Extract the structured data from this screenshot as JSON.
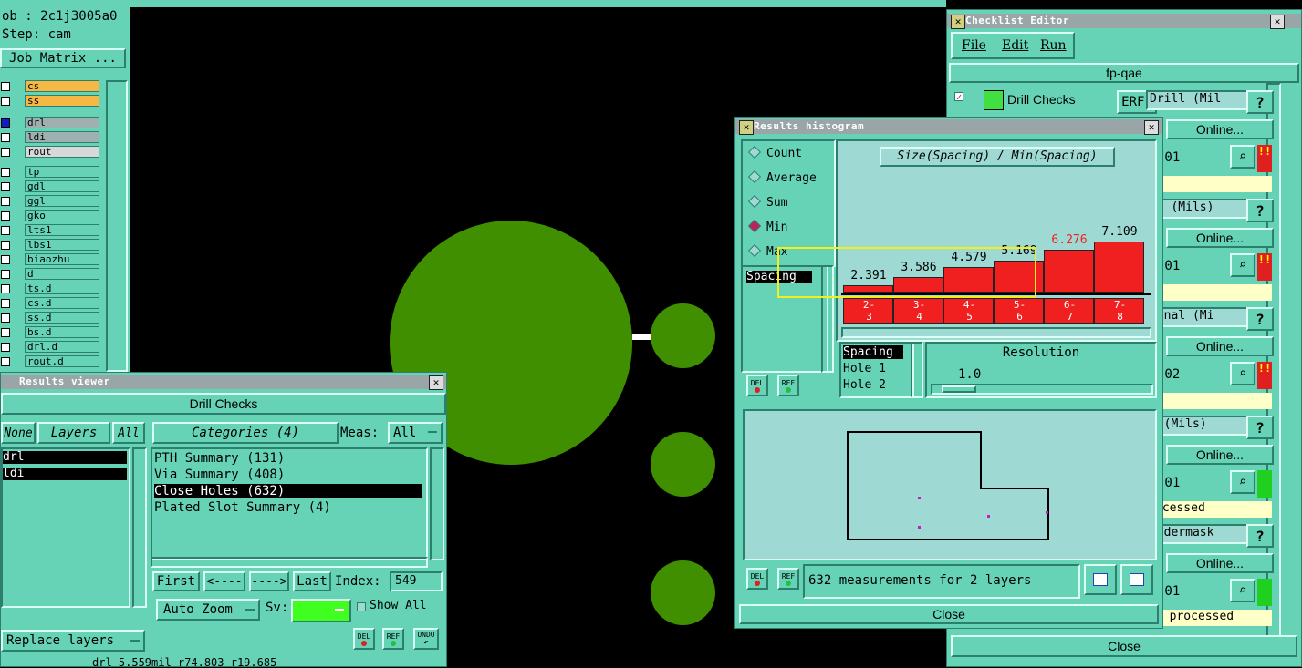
{
  "job_panel": {
    "job": "ob : 2c1j3005a0",
    "step": "Step: cam",
    "matrix_button": "Job Matrix ...",
    "layers": [
      {
        "name": "cs",
        "color": "#f5b844"
      },
      {
        "name": "ss",
        "color": "#f5b844"
      },
      {
        "name": "drl",
        "color": "#9fb0b0"
      },
      {
        "name": "ldi",
        "color": "#9fb0b0"
      },
      {
        "name": "rout",
        "color": "#d8d8d8"
      },
      {
        "name": "tp",
        "color": "#66d3b7"
      },
      {
        "name": "gdl",
        "color": "#66d3b7"
      },
      {
        "name": "ggl",
        "color": "#66d3b7"
      },
      {
        "name": "gko",
        "color": "#66d3b7"
      },
      {
        "name": "lts1",
        "color": "#66d3b7"
      },
      {
        "name": "lbs1",
        "color": "#66d3b7"
      },
      {
        "name": "biaozhu",
        "color": "#66d3b7"
      },
      {
        "name": "d",
        "color": "#66d3b7"
      },
      {
        "name": "ts.d",
        "color": "#66d3b7"
      },
      {
        "name": "cs.d",
        "color": "#66d3b7"
      },
      {
        "name": "ss.d",
        "color": "#66d3b7"
      },
      {
        "name": "bs.d",
        "color": "#66d3b7"
      },
      {
        "name": "drl.d",
        "color": "#66d3b7"
      },
      {
        "name": "rout.d",
        "color": "#66d3b7"
      }
    ]
  },
  "results_viewer": {
    "title": "Results viewer",
    "header": "Drill Checks",
    "none_btn": "None",
    "layers_btn": "Layers",
    "all_btn": "All",
    "layer_list": [
      "drl",
      "ldi"
    ],
    "categories_btn": "Categories (4)",
    "meas_label": "Meas:",
    "meas_value": "All",
    "categories": [
      "PTH Summary (131)",
      "Via Summary (408)",
      "Close Holes (632)",
      "Plated Slot Summary (4)"
    ],
    "nav": {
      "first": "First",
      "prev": "<----",
      "next": "---->",
      "last": "Last",
      "index_label": "Index:",
      "index_value": "549"
    },
    "auto_zoom": "Auto Zoom",
    "sv_label": "Sv:",
    "show_all": "Show All",
    "replace_layers": "Replace layers",
    "del": "DEL",
    "ref": "REF",
    "undo": "UNDO",
    "status": "drl 5.559mil  r74.803  r19.685"
  },
  "histogram": {
    "title": "Results histogram",
    "modes": [
      "Count",
      "Average",
      "Sum",
      "Min",
      "Max"
    ],
    "selected_mode": "Min",
    "chart_title": "Size(Spacing) / Min(Spacing)",
    "left_list": [
      "Spacing"
    ],
    "attr_list": [
      "Spacing",
      "Hole 1",
      "Hole 2"
    ],
    "resolution_label": "Resolution",
    "resolution_value": "1.0",
    "del": "DEL",
    "ref": "REF",
    "measurements": "632 measurements for 2 layers",
    "close": "Close",
    "colors": {
      "bar": "#f02020",
      "highlight": "#f0f020",
      "warn_value": "#f02020"
    }
  },
  "chart_data": {
    "type": "bar",
    "title": "Size(Spacing) / Min(Spacing)",
    "categories": [
      "2-3",
      "3-4",
      "4-5",
      "5-6",
      "6-7",
      "7-8"
    ],
    "values": [
      2.391,
      3.586,
      4.579,
      5.169,
      6.276,
      7.109
    ],
    "value_labels": [
      "2.391",
      "3.586",
      "4.579",
      "5.169",
      "6.276",
      "7.109"
    ],
    "bin_top": [
      "2-",
      "3-",
      "4-",
      "5-",
      "6-",
      "7-"
    ],
    "bin_bottom": [
      "3",
      "4",
      "5",
      "6",
      "7",
      "8"
    ],
    "ylim": [
      0,
      7.5
    ]
  },
  "checklist": {
    "title": "Checklist Editor",
    "menu": [
      "File",
      "Edit",
      "Run"
    ],
    "name": "fp-qae",
    "first_check": "Drill Checks",
    "erf_label": "ERF:",
    "erf_value": "Drill (Mil",
    "help": "?",
    "online": "Online...",
    "rows": [
      {
        "label": "Drill (Mil",
        "time": ":01",
        "flag": "!!",
        "status": ""
      },
      {
        "label": "cd (Mils)",
        "time": ":01",
        "flag": "!!",
        "status": ""
      },
      {
        "label": "ignal (Mi",
        "time": ":02",
        "flag": "!!",
        "status": ""
      },
      {
        "label": "G (Mils)",
        "time": ":01",
        "flag": "",
        "status": "ocessed"
      },
      {
        "label": "oldermask",
        "time": ":01",
        "flag": "",
        "status": "e processed"
      }
    ],
    "close": "Close"
  }
}
